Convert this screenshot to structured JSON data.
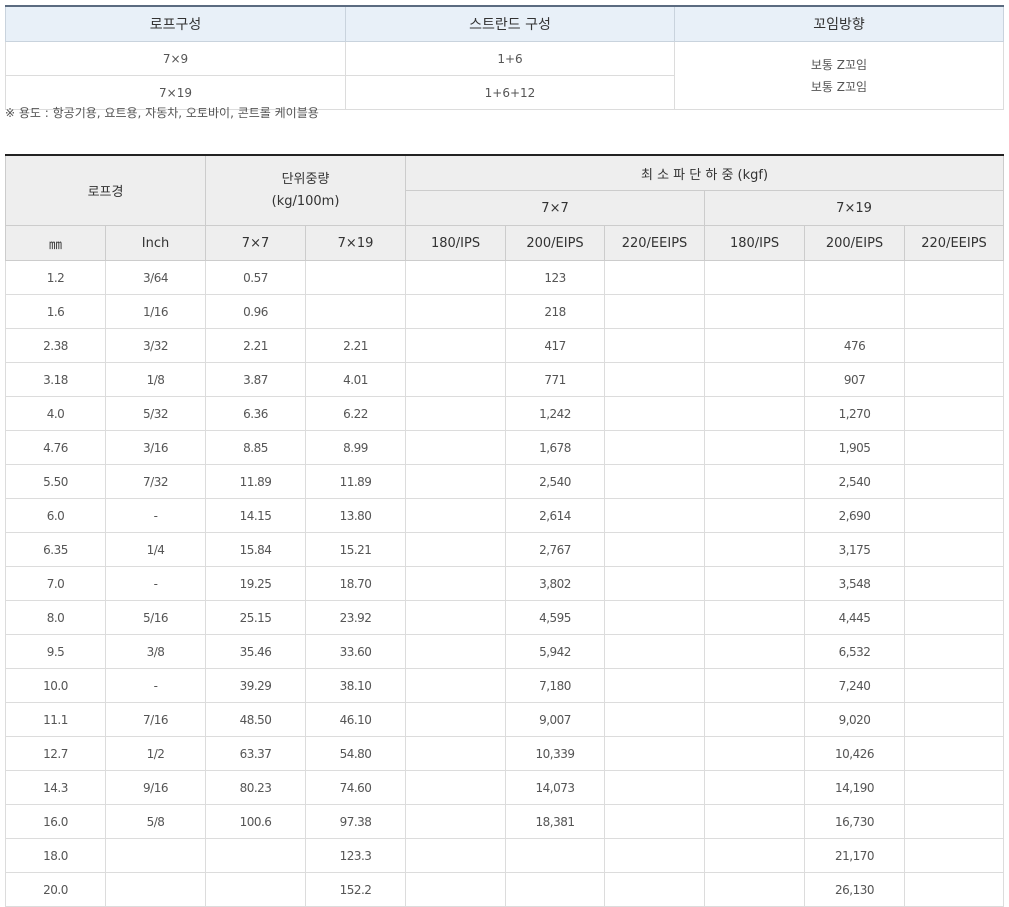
{
  "top": {
    "headers": [
      "로프구성",
      "스트란드 구성",
      "꼬임방향"
    ],
    "rows": [
      {
        "construction": "7×9",
        "strand": "1+6"
      },
      {
        "construction": "7×19",
        "strand": "1+6+12"
      }
    ],
    "twist_lines": [
      "보통 Z꼬임",
      "보통 Z꼬임"
    ]
  },
  "note": "※ 용도 : 항공기용, 요트용, 자동차, 오토바이, 콘트롤 케이블용",
  "main": {
    "rope_diameter": "로프경",
    "unit_weight_line1": "단위중량",
    "unit_weight_line2": "(kg/100m)",
    "min_breaking_load": "최 소 파 단 하 중 (kgf)",
    "group_7x7": "7×7",
    "group_7x19": "7×19",
    "sub_headers": [
      "㎜",
      "Inch",
      "7×7",
      "7×19",
      "180/IPS",
      "200/EIPS",
      "220/EEIPS",
      "180/IPS",
      "200/EIPS",
      "220/EEIPS"
    ],
    "rows": [
      [
        "1.2",
        "3/64",
        "0.57",
        "",
        "",
        "123",
        "",
        "",
        "",
        ""
      ],
      [
        "1.6",
        "1/16",
        "0.96",
        "",
        "",
        "218",
        "",
        "",
        "",
        ""
      ],
      [
        "2.38",
        "3/32",
        "2.21",
        "2.21",
        "",
        "417",
        "",
        "",
        "476",
        ""
      ],
      [
        "3.18",
        "1/8",
        "3.87",
        "4.01",
        "",
        "771",
        "",
        "",
        "907",
        ""
      ],
      [
        "4.0",
        "5/32",
        "6.36",
        "6.22",
        "",
        "1,242",
        "",
        "",
        "1,270",
        ""
      ],
      [
        "4.76",
        "3/16",
        "8.85",
        "8.99",
        "",
        "1,678",
        "",
        "",
        "1,905",
        ""
      ],
      [
        "5.50",
        "7/32",
        "11.89",
        "11.89",
        "",
        "2,540",
        "",
        "",
        "2,540",
        ""
      ],
      [
        "6.0",
        "-",
        "14.15",
        "13.80",
        "",
        "2,614",
        "",
        "",
        "2,690",
        ""
      ],
      [
        "6.35",
        "1/4",
        "15.84",
        "15.21",
        "",
        "2,767",
        "",
        "",
        "3,175",
        ""
      ],
      [
        "7.0",
        "-",
        "19.25",
        "18.70",
        "",
        "3,802",
        "",
        "",
        "3,548",
        ""
      ],
      [
        "8.0",
        "5/16",
        "25.15",
        "23.92",
        "",
        "4,595",
        "",
        "",
        "4,445",
        ""
      ],
      [
        "9.5",
        "3/8",
        "35.46",
        "33.60",
        "",
        "5,942",
        "",
        "",
        "6,532",
        ""
      ],
      [
        "10.0",
        "-",
        "39.29",
        "38.10",
        "",
        "7,180",
        "",
        "",
        "7,240",
        ""
      ],
      [
        "11.1",
        "7/16",
        "48.50",
        "46.10",
        "",
        "9,007",
        "",
        "",
        "9,020",
        ""
      ],
      [
        "12.7",
        "1/2",
        "63.37",
        "54.80",
        "",
        "10,339",
        "",
        "",
        "10,426",
        ""
      ],
      [
        "14.3",
        "9/16",
        "80.23",
        "74.60",
        "",
        "14,073",
        "",
        "",
        "14,190",
        ""
      ],
      [
        "16.0",
        "5/8",
        "100.6",
        "97.38",
        "",
        "18,381",
        "",
        "",
        "16,730",
        ""
      ],
      [
        "18.0",
        "",
        "",
        "123.3",
        "",
        "",
        "",
        "",
        "21,170",
        ""
      ],
      [
        "20.0",
        "",
        "",
        "152.2",
        "",
        "",
        "",
        "",
        "26,130",
        ""
      ]
    ]
  }
}
